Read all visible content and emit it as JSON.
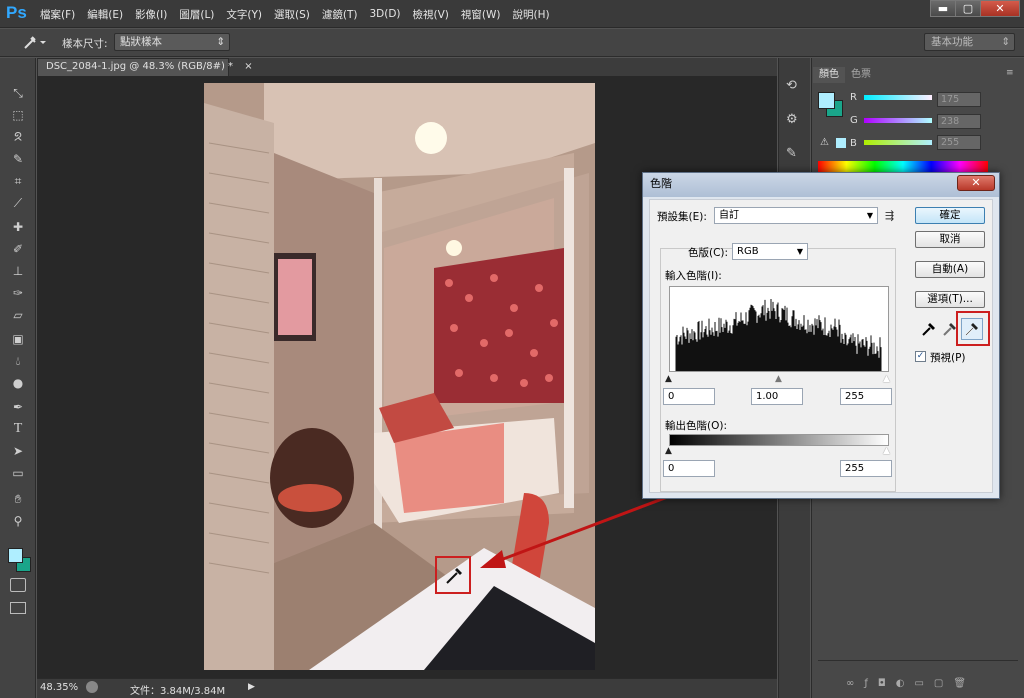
{
  "app": {
    "logo": "Ps"
  },
  "menu": [
    "檔案(F)",
    "編輯(E)",
    "影像(I)",
    "圖層(L)",
    "文字(Y)",
    "選取(S)",
    "濾鏡(T)",
    "3D(D)",
    "檢視(V)",
    "視窗(W)",
    "說明(H)"
  ],
  "window_controls": {
    "minimize": "▬",
    "maximize": "▢",
    "close": "✕"
  },
  "options_bar": {
    "tool_icon": "eyedropper-icon",
    "sample_size_label": "樣本尺寸:",
    "sample_size_value": "點狀樣本",
    "workspace": "基本功能"
  },
  "document": {
    "tab_title": "DSC_2084-1.jpg @ 48.3% (RGB/8#) *",
    "tab_close": "×",
    "zoom": "48.35%",
    "doc_size": "文件：3.84M/3.84M"
  },
  "tools": [
    "move-icon",
    "marquee-icon",
    "lasso-icon",
    "quick-select-icon",
    "crop-icon",
    "eyedropper-icon",
    "healing-brush-icon",
    "brush-icon",
    "clone-stamp-icon",
    "history-brush-icon",
    "eraser-icon",
    "gradient-icon",
    "blur-icon",
    "dodge-icon",
    "pen-icon",
    "type-icon",
    "path-select-icon",
    "shape-icon",
    "hand-icon",
    "zoom-icon"
  ],
  "color_panel": {
    "tabs": [
      "顏色",
      "色票"
    ],
    "channels": [
      {
        "label": "R",
        "value": "175"
      },
      {
        "label": "G",
        "value": "238"
      },
      {
        "label": "B",
        "value": "255"
      }
    ],
    "fg_color": "#afeeff",
    "bg_color": "#1aa58a"
  },
  "levels_dialog": {
    "title": "色階",
    "close": "✕",
    "preset_label": "預設集(E):",
    "preset_value": "自訂",
    "channel_label": "色版(C):",
    "channel_value": "RGB",
    "input_levels_label": "輸入色階(I):",
    "input_values": [
      "0",
      "1.00",
      "255"
    ],
    "output_levels_label": "輸出色階(O):",
    "output_values": [
      "0",
      "255"
    ],
    "buttons": {
      "ok": "確定",
      "cancel": "取消",
      "auto": "自動(A)",
      "options": "選項(T)..."
    },
    "preview_label": "預視(P)",
    "preview_checked": true
  },
  "colors": {
    "accent_red": "#cc1f1f",
    "ps_blue": "#31a8ff"
  }
}
